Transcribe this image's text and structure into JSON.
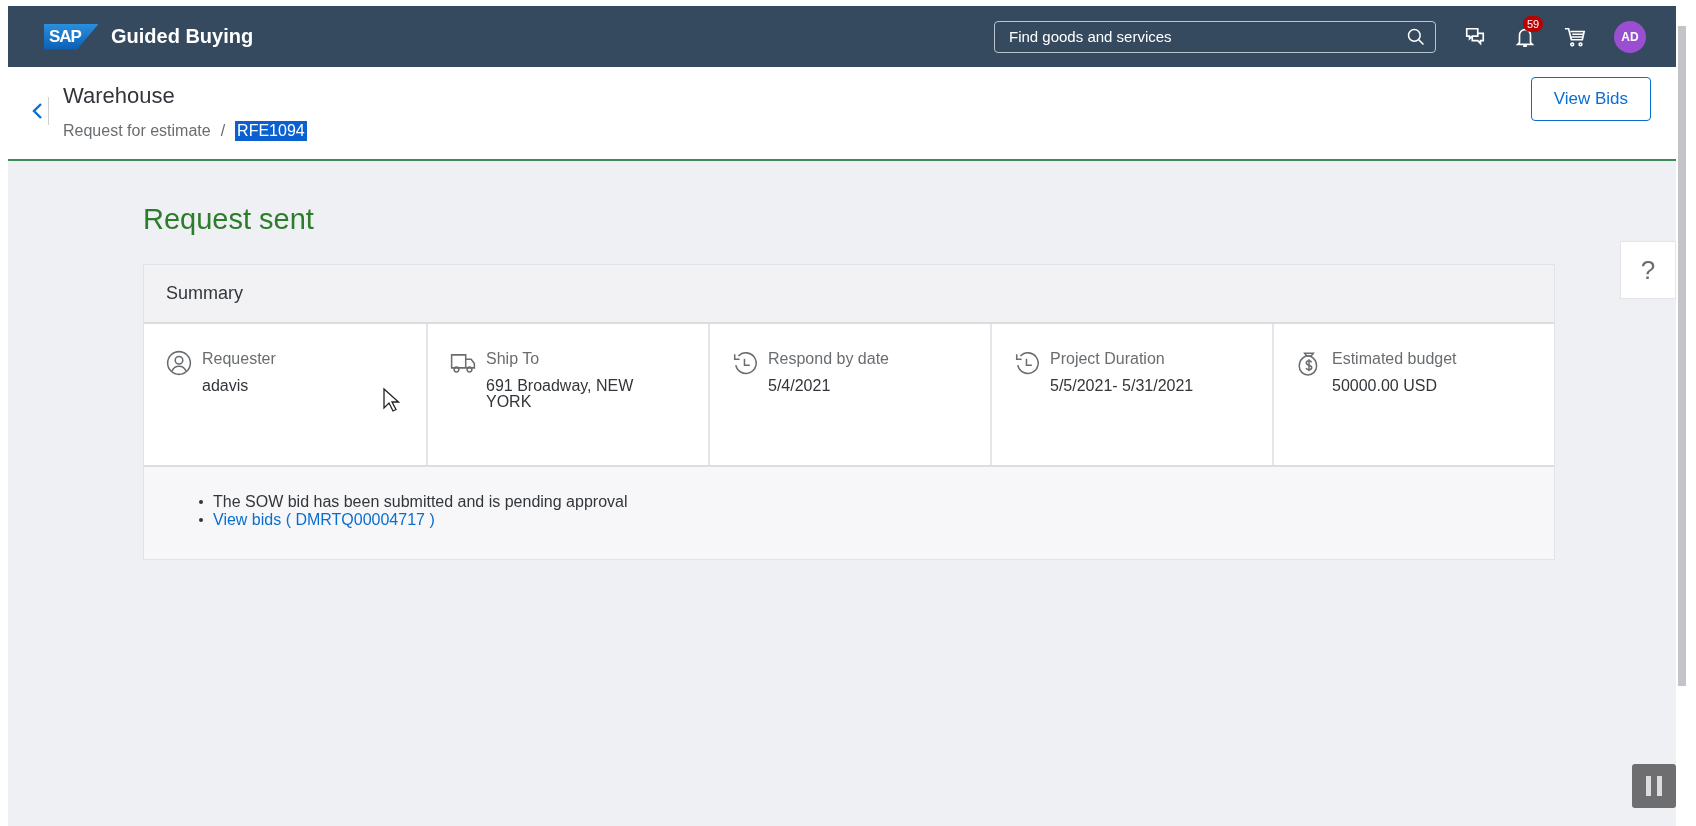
{
  "shell": {
    "logo": "SAP",
    "title": "Guided Buying",
    "search": {
      "placeholder": "Find goods and services"
    },
    "notifications": {
      "count": "59"
    },
    "avatar": "AD"
  },
  "header": {
    "title": "Warehouse",
    "breadcrumb_separator": "/",
    "breadcrumbs": [
      {
        "text": "Request for estimate",
        "text_selected": false
      },
      {
        "text": "RFE1094",
        "text_selected": true
      }
    ],
    "button": "View Bids"
  },
  "status_title": "Request sent",
  "summary": {
    "title": "Summary",
    "fields": [
      {
        "kind": "person",
        "label": "Requester",
        "value": "adavis"
      },
      {
        "kind": "truck",
        "label": "Ship To",
        "value": "691 Broadway, NEW YORK"
      },
      {
        "kind": "history",
        "label": "Respond by date",
        "value": "5/4/2021"
      },
      {
        "kind": "history",
        "label": "Project Duration",
        "value": "5/5/2021- 5/31/2021"
      },
      {
        "kind": "money",
        "label": "Estimated budget",
        "value": "50000.00 USD"
      }
    ],
    "notes": [
      {
        "kind": "text",
        "text": "The SOW bid has been submitted and is pending approval"
      },
      {
        "kind": "link",
        "text": "View bids ( DMRTQ00004717 )"
      }
    ]
  },
  "help": "?"
}
